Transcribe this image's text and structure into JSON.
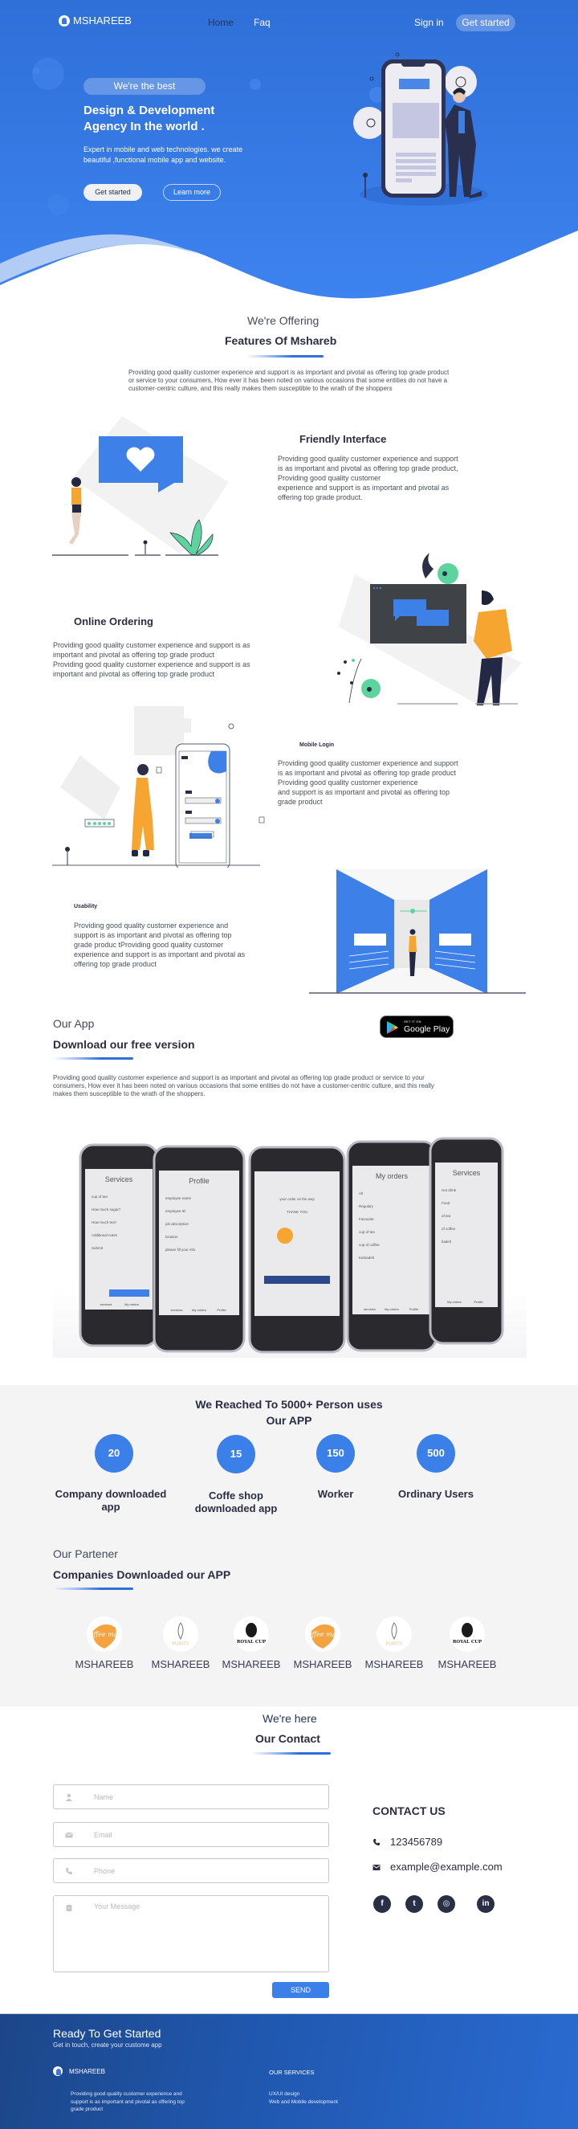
{
  "colors": {
    "brand_blue": "#3b7fe8",
    "hero_top": "#2f6fd8",
    "hero_bottom": "#3c82ef",
    "dark_text": "#2b2d42",
    "footer_dark": "#1c4688",
    "accent_orange": "#f7a531",
    "accent_green": "#5dd39e"
  },
  "nav": {
    "brand": "MSHAREEB",
    "links": [
      "Home",
      "Faq"
    ],
    "active_link": "Home",
    "sign_in": "Sign in",
    "get_started": "Get started"
  },
  "hero": {
    "badge": "We're the best",
    "title_line1": "Design & Development",
    "title_line2": "Agency In the world .",
    "subtitle": "Expert in mobile and web technologies. we create beautiful ,functional mobile app and website.",
    "primary_button": "Get started",
    "secondary_button": "Learn more",
    "illustration": "phone-with-man-illustration"
  },
  "features": {
    "kicker": "We're Offering",
    "title": "Features Of Mshareb",
    "intro": "Providing good quality customer experience and support is as important and pivotal as offering top grade product or service to your consumers, How ever it has been noted on  various occasions that some entities do not have a customer-centric culture, and this really makes them  susceptible to the wrath of the shoppers",
    "items": [
      {
        "title": "Friendly Interface",
        "text": "Providing good quality customer experience and support\nis as important and pivotal as offering top grade product,\nProviding good quality customer\nexperience and support is as important and pivotal as\noffering top grade product.",
        "illustration": "heart-message-illustration"
      },
      {
        "title": "Online Ordering",
        "text": "Providing good quality customer experience and support is as\nimportant and pivotal as offering top grade product\nProviding good quality customer experience and support is as\nimportant and pivotal as offering top grade product",
        "illustration": "chat-screen-illustration"
      },
      {
        "title": "Mobile Login",
        "text": "Providing good quality customer experience and support\nis as important and pivotal as offering top grade product\nProviding good quality customer experience\nand support is as important and pivotal as offering top\ngrade product",
        "illustration": "mobile-login-illustration"
      },
      {
        "title": "Usability",
        "text": "Providing good quality customer experience and\nsupport is as important and pivotal as offering top\ngrade produc tProviding good quality customer\nexperience and support is as important and pivotal as\noffering top grade product",
        "illustration": "gallery-hall-illustration"
      }
    ]
  },
  "app": {
    "kicker": "Our App",
    "title": "Download our free version",
    "text": "Providing good quality customer experience and support is as important and pivotal as offering top grade product or service to your consumers, How ever it has been noted on  various occasions that some entities do not have a customer-centric culture, and this really makes them  susceptible to the wrath of the shoppers.",
    "store_badge": {
      "small": "GET IT ON",
      "big": "Google Play"
    },
    "phones": [
      {
        "screen": "Services",
        "lines": [
          "cup of tea",
          "How much sugar?",
          "How much tea?",
          "Additional notes",
          "Submit"
        ],
        "tabs": [
          "services",
          "My orders"
        ]
      },
      {
        "screen": "Profile",
        "lines": [
          "employee name",
          "employee ID",
          "job description",
          "location",
          "please fill your info"
        ],
        "tabs": [
          "services",
          "My orders",
          "Profile"
        ]
      },
      {
        "screen": "",
        "lines": [
          "your order on the way",
          "THANK YOU"
        ],
        "tabs": []
      },
      {
        "screen": "My orders",
        "lines": [
          "All",
          "Regulary",
          "Favourite",
          "cup of tea",
          "cup of coffee",
          "Karkadeh"
        ],
        "tabs": [
          "services",
          "My orders",
          "Profile"
        ]
      },
      {
        "screen": "Services",
        "lines": [
          "Hot drink",
          "Food",
          "of tea",
          "of coffee",
          "kadeh"
        ],
        "tabs": [
          "My orders",
          "Profile"
        ]
      }
    ]
  },
  "stats": {
    "title_line1": "We Reached To 5000+ Person uses",
    "title_line2": "Our APP",
    "items": [
      {
        "value": "20",
        "label_line1": "Company downloaded",
        "label_line2": "app"
      },
      {
        "value": "15",
        "label_line1": "Coffe shop",
        "label_line2": "downloaded app"
      },
      {
        "value": "150",
        "label_line1": "Worker",
        "label_line2": ""
      },
      {
        "value": "500",
        "label_line1": "Ordinary Users",
        "label_line2": ""
      }
    ]
  },
  "partners": {
    "kicker": "Our Partener",
    "title": "Companies Downloaded our APP",
    "items": [
      {
        "logo": "coffee-mate",
        "name": "MSHAREEB"
      },
      {
        "logo": "purity-coffee",
        "name": "MSHAREEB"
      },
      {
        "logo": "royal-cup",
        "name": "MSHAREEB"
      },
      {
        "logo": "coffee-mate",
        "name": "MSHAREEB"
      },
      {
        "logo": "purity-coffee",
        "name": "MSHAREEB"
      },
      {
        "logo": "royal-cup",
        "name": "MSHAREEB"
      }
    ],
    "logo_text": {
      "coffee-mate": "Coffee mate",
      "purity-coffee": "PURITY",
      "royal-cup": "ROYAL CUP"
    }
  },
  "contact": {
    "kicker": "We're here",
    "title": "Our Contact",
    "form": {
      "name_placeholder": "Name",
      "email_placeholder": "Email",
      "phone_placeholder": "Phone",
      "message_placeholder": "Your Message",
      "send": "SEND"
    },
    "info": {
      "heading": "CONTACT US",
      "phone": "123456789",
      "email": "example@example.com",
      "socials": [
        "facebook",
        "twitter",
        "instagram",
        "linkedin"
      ],
      "social_glyphs": {
        "facebook": "f",
        "twitter": "t",
        "instagram": "◎",
        "linkedin": "in"
      }
    }
  },
  "footer": {
    "title": "Ready To Get Started",
    "subtitle": "Get in touch, create your custome app",
    "brand": "MSHAREEB",
    "description": "Providing good quality customer experience and support is as important and pivotal as offering top grade product",
    "services_heading": "OUR SERVICES",
    "services": [
      "UX/UI design",
      "Web and Mobile development"
    ]
  }
}
